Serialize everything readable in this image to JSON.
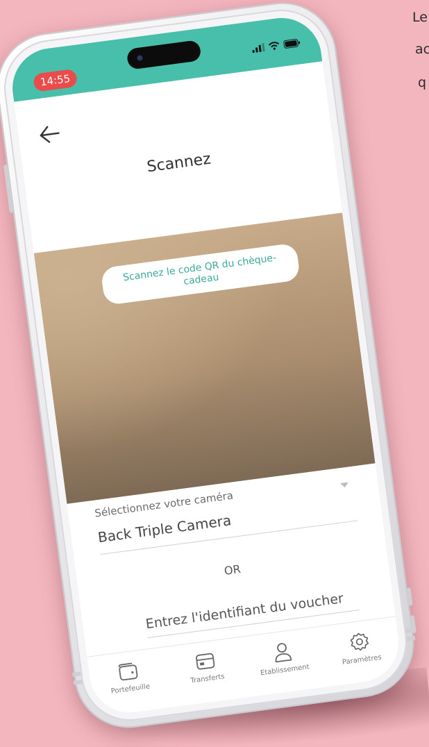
{
  "background_text": {
    "line_1": "Le",
    "line_2": "ac",
    "line_3": "q"
  },
  "status_bar": {
    "time": "14:55",
    "color": "#47bfaa",
    "time_pill_color": "#ea4b4b"
  },
  "header": {
    "title": "Scannez"
  },
  "camera": {
    "hint": "Scannez le code QR du chèque-cadeau"
  },
  "camera_select": {
    "label": "Sélectionnez votre caméra",
    "selected": "Back Triple Camera"
  },
  "separator": "OR",
  "voucher": {
    "placeholder": "Entrez l'identifiant du voucher"
  },
  "bottom_nav": {
    "items": [
      {
        "label": "Portefeuille",
        "icon": "wallet-icon"
      },
      {
        "label": "Transferts",
        "icon": "card-icon"
      },
      {
        "label": "Etablissement",
        "icon": "user-icon"
      },
      {
        "label": "Paramètres",
        "icon": "gear-icon"
      }
    ]
  }
}
